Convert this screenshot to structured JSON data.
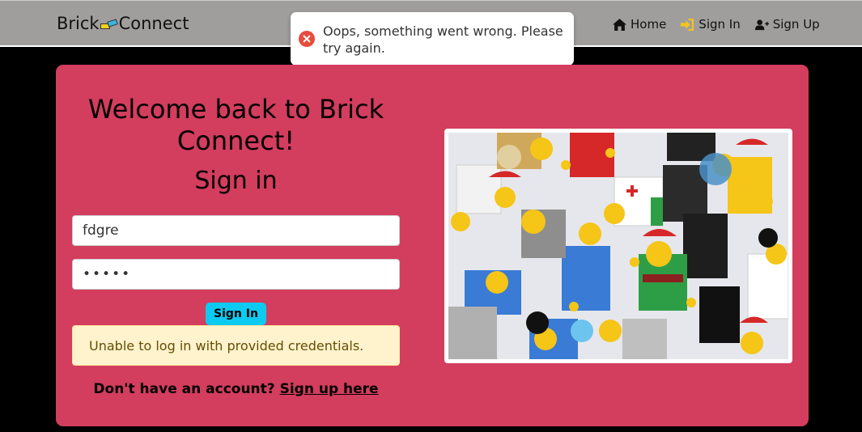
{
  "navbar": {
    "brand_left": "Brick",
    "brand_right": "Connect",
    "links": [
      {
        "label": "Home",
        "icon": "home-icon"
      },
      {
        "label": "Sign In",
        "icon": "sign-in-icon"
      },
      {
        "label": "Sign Up",
        "icon": "user-plus-icon"
      }
    ]
  },
  "toast": {
    "message": "Oops, something went wrong. Please try again.",
    "icon": "error-icon",
    "icon_color": "#e74c3c"
  },
  "card": {
    "welcome": "Welcome back to Brick Connect!",
    "title": "Sign in",
    "username_value": "fdgre",
    "password_value": "•••••",
    "submit_label": "Sign In",
    "error_message": "Unable to log in with provided credentials.",
    "signup_prompt": "Don't have an account?",
    "signup_link": "Sign up here",
    "background_color": "#d33d5e"
  },
  "image": {
    "description_icon": "lego-minifigures-photo"
  }
}
